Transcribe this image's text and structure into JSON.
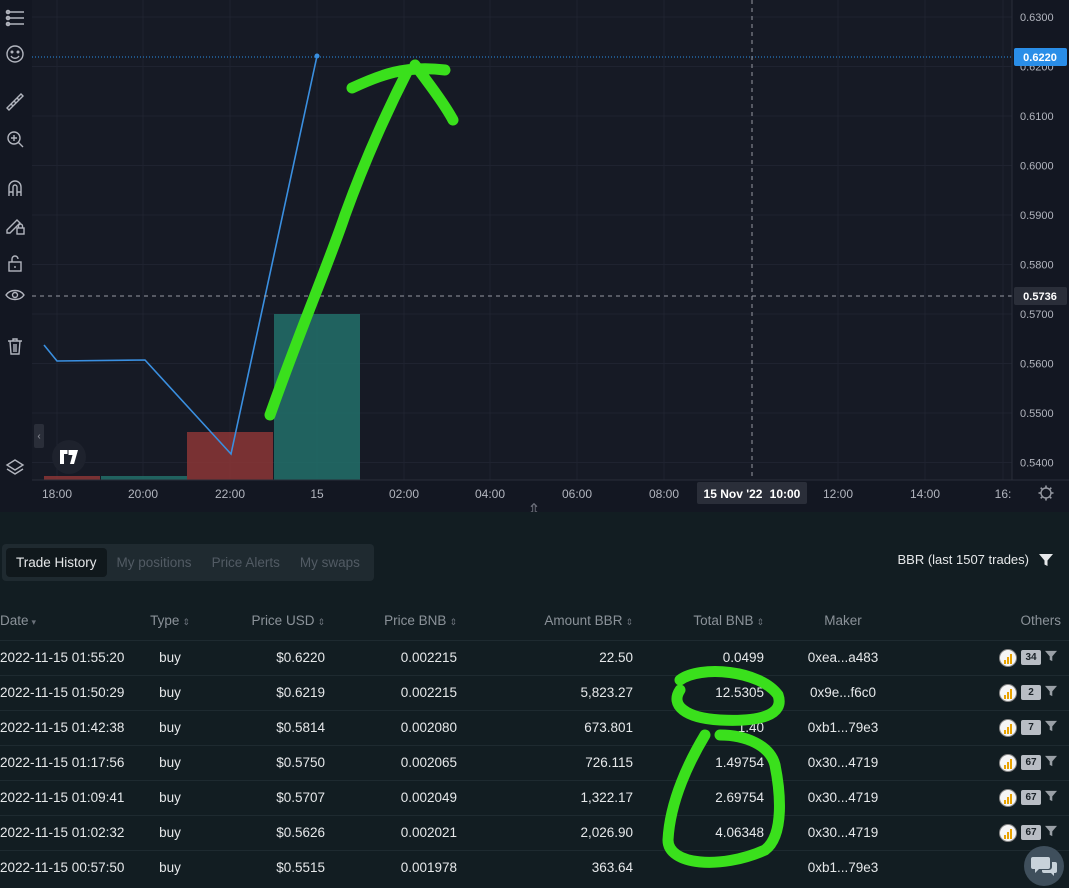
{
  "chart": {
    "price_axis": [
      "0.6300",
      "0.6200",
      "0.6100",
      "0.6000",
      "0.5900",
      "0.5800",
      "0.5700",
      "0.5600",
      "0.5500",
      "0.5400"
    ],
    "last_price_label": "0.6220",
    "crosshair_price_label": "0.5736",
    "time_axis": [
      "18:00",
      "20:00",
      "22:00",
      "15",
      "02:00",
      "04:00",
      "06:00",
      "08:00",
      "12:00",
      "14:00",
      "16:"
    ],
    "crosshair_time_label": "15 Nov '22",
    "crosshair_time_value": "10:00",
    "colors": {
      "line": "#3a8fe0",
      "up_bar": "#22706a",
      "down_bar": "#8b3636",
      "last_price": "#2a8ee8",
      "annotation": "#3ae01c"
    }
  },
  "toolbar": {
    "icons": [
      "indicators-icon",
      "smiley-icon",
      "ruler-icon",
      "zoom-in-icon",
      "magnet-icon",
      "lock-pencil-icon",
      "unlock-icon",
      "eye-icon",
      "trash-icon",
      "layers-icon"
    ]
  },
  "tabs": [
    {
      "label": "Trade History",
      "active": true
    },
    {
      "label": "My positions",
      "active": false
    },
    {
      "label": "Price Alerts",
      "active": false
    },
    {
      "label": "My swaps",
      "active": false
    }
  ],
  "pair_filter": {
    "label": "BBR (last 1507 trades)"
  },
  "table": {
    "columns": [
      "Date",
      "Type",
      "Price USD",
      "Price BNB",
      "Amount BBR",
      "Total BNB",
      "Maker",
      "Others"
    ],
    "rows": [
      {
        "date": "2022-11-15 01:55:20",
        "type": "buy",
        "price_usd": "$0.6220",
        "price_bnb": "0.002215",
        "amount": "22.50",
        "total": "0.0499",
        "maker": "0xea...a483",
        "count": "34"
      },
      {
        "date": "2022-11-15 01:50:29",
        "type": "buy",
        "price_usd": "$0.6219",
        "price_bnb": "0.002215",
        "amount": "5,823.27",
        "total": "12.5305",
        "maker": "0x9e...f6c0",
        "count": "2"
      },
      {
        "date": "2022-11-15 01:42:38",
        "type": "buy",
        "price_usd": "$0.5814",
        "price_bnb": "0.002080",
        "amount": "673.801",
        "total": "1.40",
        "maker": "0xb1...79e3",
        "count": "7"
      },
      {
        "date": "2022-11-15 01:17:56",
        "type": "buy",
        "price_usd": "$0.5750",
        "price_bnb": "0.002065",
        "amount": "726.115",
        "total": "1.49754",
        "maker": "0x30...4719",
        "count": "67"
      },
      {
        "date": "2022-11-15 01:09:41",
        "type": "buy",
        "price_usd": "$0.5707",
        "price_bnb": "0.002049",
        "amount": "1,322.17",
        "total": "2.69754",
        "maker": "0x30...4719",
        "count": "67"
      },
      {
        "date": "2022-11-15 01:02:32",
        "type": "buy",
        "price_usd": "$0.5626",
        "price_bnb": "0.002021",
        "amount": "2,026.90",
        "total": "4.06348",
        "maker": "0x30...4719",
        "count": "67"
      },
      {
        "date": "2022-11-15 00:57:50",
        "type": "buy",
        "price_usd": "$0.5515",
        "price_bnb": "0.001978",
        "amount": "363.64",
        "total": "",
        "maker": "0xb1...79e3",
        "count": ""
      }
    ]
  }
}
